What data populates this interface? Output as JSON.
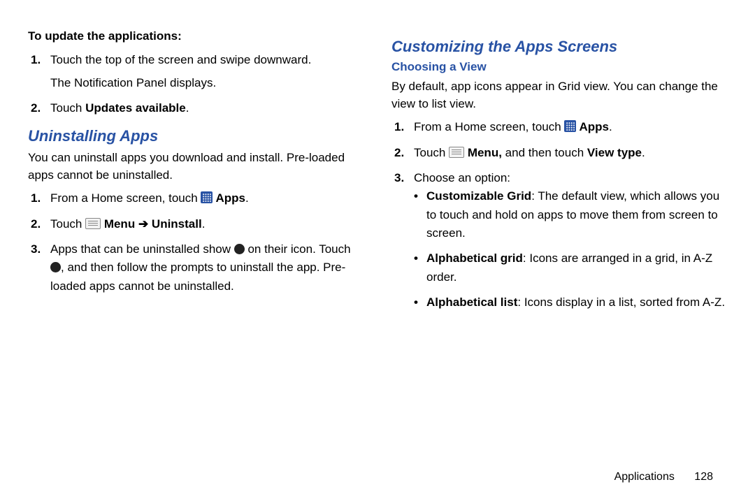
{
  "left": {
    "update_heading": "To update the applications:",
    "update_steps": {
      "s1a": "Touch the top of the screen and swipe downward.",
      "s1b": "The Notification Panel displays.",
      "s2_pre": "Touch ",
      "s2_bold": "Updates available",
      "s2_post": "."
    },
    "uninstall_heading": "Uninstalling Apps",
    "uninstall_intro": "You can uninstall apps you download and install. Pre-loaded apps cannot be uninstalled.",
    "uninstall_steps": {
      "s1_pre": "From a Home screen, touch ",
      "s1_bold": " Apps",
      "s1_post": ".",
      "s2_pre": "Touch ",
      "s2_menu": " Menu ",
      "s2_arrow": "➔",
      "s2_uninstall": " Uninstall",
      "s2_post": ".",
      "s3_a": "Apps that can be uninstalled show ",
      "s3_b": " on their icon. Touch ",
      "s3_c": ", and then follow the prompts to uninstall the app. Pre-loaded apps cannot be uninstalled."
    }
  },
  "right": {
    "custom_heading": "Customizing the Apps Screens",
    "choose_heading": "Choosing a View",
    "choose_intro": "By default, app icons appear in Grid view. You can change the view to list view.",
    "steps": {
      "s1_pre": "From a Home screen, touch ",
      "s1_bold": " Apps",
      "s1_post": ".",
      "s2_pre": "Touch ",
      "s2_menu": " Menu,",
      "s2_mid": " and then touch ",
      "s2_vt": "View type",
      "s2_post": ".",
      "s3": "Choose an option:"
    },
    "options": {
      "a_label": "Customizable Grid",
      "a_text": ": The default view, which allows you to touch and hold on apps to move them from screen to screen.",
      "b_label": "Alphabetical grid",
      "b_text": ": Icons are arranged in a grid, in A-Z order.",
      "c_label": "Alphabetical list",
      "c_text": ": Icons display in a list, sorted from A-Z."
    }
  },
  "footer": {
    "label": "Applications",
    "page": "128"
  }
}
